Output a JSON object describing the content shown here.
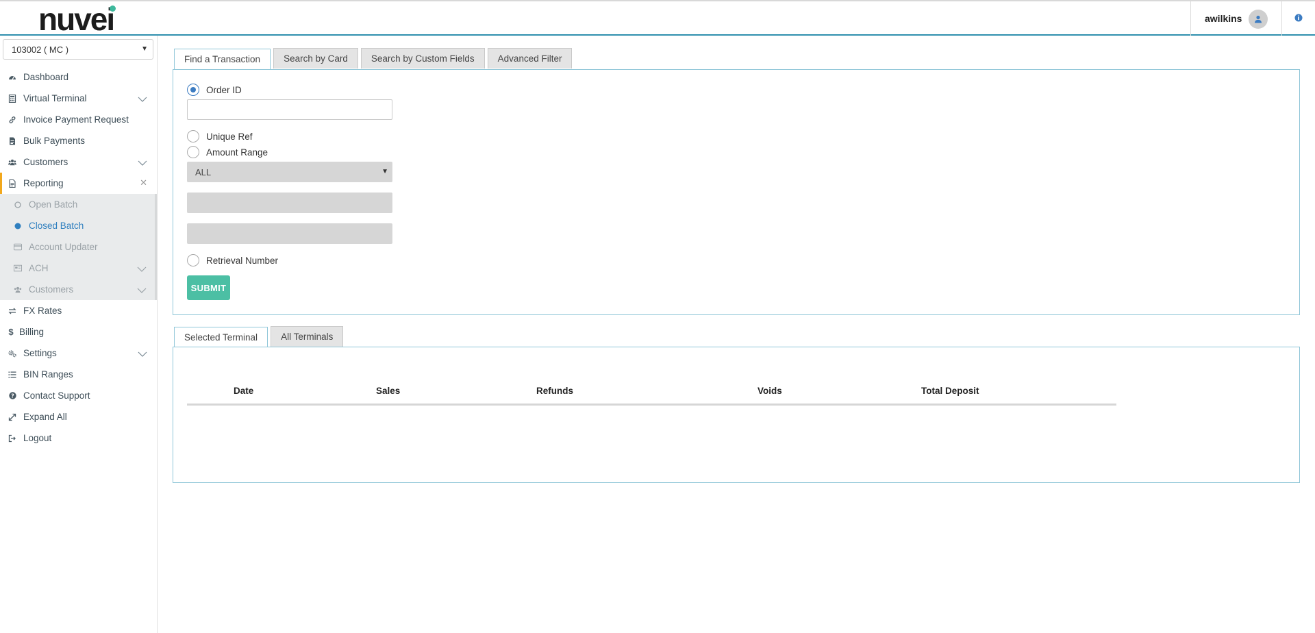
{
  "header": {
    "logo_text": "nuvei",
    "user_name": "awilkins",
    "avatar_icon": "user-icon",
    "info_icon": "info-icon",
    "accent_color": "#2f8fae"
  },
  "sidebar": {
    "merchant_select": "103002 ( MC )",
    "items": [
      {
        "label": "Dashboard",
        "icon": "dashboard-icon"
      },
      {
        "label": "Virtual Terminal",
        "icon": "calculator-icon"
      },
      {
        "label": "Invoice Payment Request",
        "icon": "link-icon"
      },
      {
        "label": "Bulk Payments",
        "icon": "document-icon"
      },
      {
        "label": "Customers",
        "icon": "users-icon"
      },
      {
        "label": "Reporting",
        "icon": "report-icon"
      }
    ],
    "reporting_sub": [
      {
        "label": "Open Batch",
        "icon": "circle-outline-icon"
      },
      {
        "label": "Closed Batch",
        "icon": "circle-filled-icon"
      },
      {
        "label": "Account Updater",
        "icon": "credit-card-icon"
      },
      {
        "label": "ACH",
        "icon": "bank-icon"
      },
      {
        "label": "Customers",
        "icon": "users-icon"
      }
    ],
    "items_after": [
      {
        "label": "FX Rates",
        "icon": "exchange-icon"
      },
      {
        "label": "Billing",
        "icon": "dollar-icon"
      },
      {
        "label": "Settings",
        "icon": "gears-icon"
      },
      {
        "label": "BIN Ranges",
        "icon": "list-icon"
      },
      {
        "label": "Contact Support",
        "icon": "question-icon"
      },
      {
        "label": "Expand All",
        "icon": "expand-icon"
      },
      {
        "label": "Logout",
        "icon": "logout-icon"
      }
    ]
  },
  "search": {
    "tabs": [
      "Find a Transaction",
      "Search by Card",
      "Search by Custom Fields",
      "Advanced Filter"
    ],
    "order_id_label": "Order ID",
    "order_id_value": "",
    "unique_ref_label": "Unique Ref",
    "amount_range_label": "Amount Range",
    "amount_range_select": "ALL",
    "retrieval_label": "Retrieval Number",
    "submit_label": "SUBMIT",
    "submit_color": "#4cbfa4"
  },
  "summary": {
    "tabs": [
      "Selected Terminal",
      "All Terminals"
    ],
    "columns": [
      "Date",
      "Sales",
      "Refunds",
      "Voids",
      "Total Deposit"
    ]
  }
}
